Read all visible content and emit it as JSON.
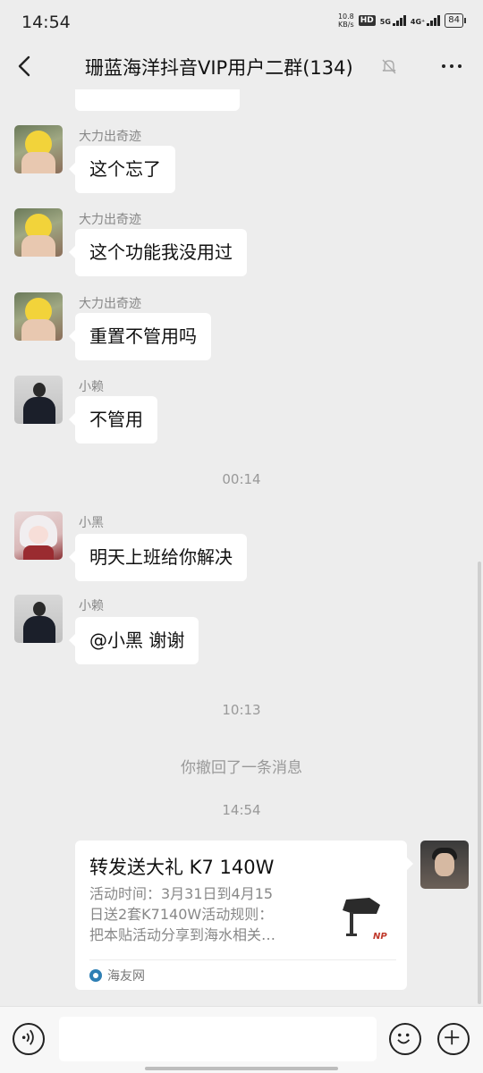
{
  "status_bar": {
    "time": "14:54",
    "net_speed_value": "10.8",
    "net_speed_unit": "KB/s",
    "hd_label": "HD",
    "net_5g": "5G",
    "net_4g": "4G⁺",
    "battery": "84"
  },
  "header": {
    "title": "珊蓝海洋抖音VIP用户二群(134)"
  },
  "messages": [
    {
      "sender": "大力出奇迹",
      "text": "这个忘了"
    },
    {
      "sender": "大力出奇迹",
      "text": "这个功能我没用过"
    },
    {
      "sender": "大力出奇迹",
      "text": "重置不管用吗"
    },
    {
      "sender": "小赖",
      "text": "不管用"
    },
    {
      "sender": "小黑",
      "text": "明天上班给你解决"
    },
    {
      "sender": "小赖",
      "text": "@小黑  谢谢"
    }
  ],
  "timestamps": [
    "00:14",
    "10:13",
    "14:54"
  ],
  "recall_notice": "你撤回了一条消息",
  "link_card": {
    "title": "转发送大礼 K7 140W",
    "desc_lines": [
      "活动时间：3月31日到4月15",
      "日送2套K7140W活动规则：",
      "把本贴活动分享到海水相关…"
    ],
    "source": "海友网",
    "thumb_brand": "NP"
  },
  "icons": {
    "back": "back-arrow-icon",
    "mute": "mute-bell-icon",
    "more": "more-dots-icon",
    "voice": "voice-icon",
    "emoji": "emoji-icon",
    "plus": "plus-icon"
  }
}
